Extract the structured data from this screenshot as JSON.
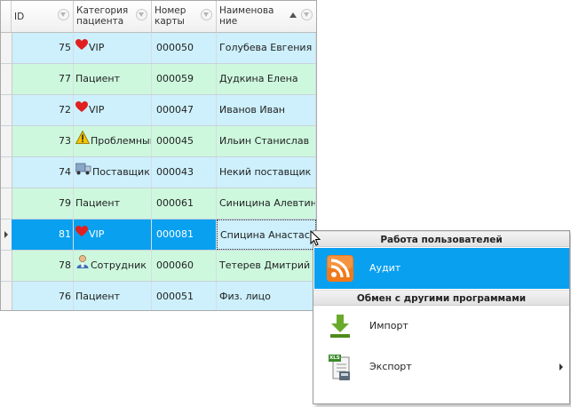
{
  "grid": {
    "columns": [
      {
        "label": "ID"
      },
      {
        "label": "Категория пациента"
      },
      {
        "label": "Номер карты"
      },
      {
        "label": "Наименова ние"
      }
    ],
    "header": {
      "id": "ID",
      "cat_l1": "Категория",
      "cat_l2": "пациента",
      "card_l1": "Номер",
      "card_l2": "карты",
      "name_l1": "Наименова",
      "name_l2": "ние"
    },
    "rows": [
      {
        "id": "75",
        "category": "VIP",
        "category_icon": "heart-icon",
        "card": "000050",
        "name": "Голубева Евгения"
      },
      {
        "id": "77",
        "category": "Пациент",
        "category_icon": "",
        "card": "000059",
        "name": "Дудкина Елена"
      },
      {
        "id": "72",
        "category": "VIP",
        "category_icon": "heart-icon",
        "card": "000047",
        "name": "Иванов Иван"
      },
      {
        "id": "73",
        "category": "Проблемный",
        "category_icon": "warning-icon",
        "card": "000045",
        "name": "Ильин Станислав"
      },
      {
        "id": "74",
        "category": "Поставщик",
        "category_icon": "truck-icon",
        "card": "000043",
        "name": "Некий поставщик"
      },
      {
        "id": "79",
        "category": "Пациент",
        "category_icon": "",
        "card": "000061",
        "name": "Синицина Алевтина"
      },
      {
        "id": "81",
        "category": "VIP",
        "category_icon": "heart-icon",
        "card": "000081",
        "name": "Спицина Анастасия"
      },
      {
        "id": "78",
        "category": "Сотрудник",
        "category_icon": "employee-icon",
        "card": "000060",
        "name": "Тетерев Дмитрий"
      },
      {
        "id": "76",
        "category": "Пациент",
        "category_icon": "",
        "card": "000051",
        "name": "Физ. лицо"
      }
    ],
    "selected_row": 6,
    "sorted_column": "name",
    "sort_direction": "ascending"
  },
  "menu": {
    "section1": "Работа пользователей",
    "audit": "Аудит",
    "section2": "Обмен с другими программами",
    "import": "Импорт",
    "export": "Экспорт",
    "export_icon_text": "XLS"
  },
  "colors": {
    "row_blue": "#cdf0fc",
    "row_green": "#cdf8de",
    "selection": "#0aa0f0",
    "heart": "#e02020",
    "rss": "#f07a1a",
    "import_arrow": "#6aaa2a"
  }
}
